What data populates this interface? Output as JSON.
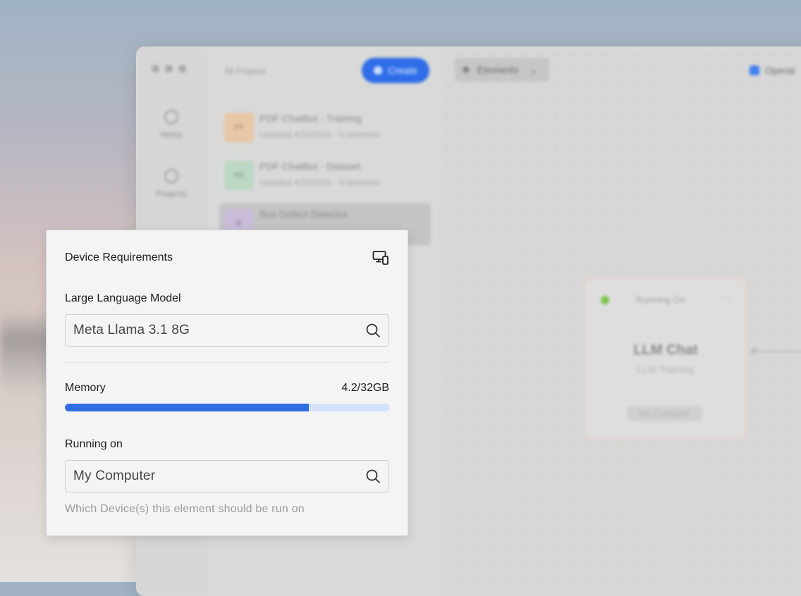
{
  "background_app": {
    "rail": [
      {
        "label": "Hosts"
      },
      {
        "label": "Projects"
      }
    ],
    "list_title": "All Projects",
    "create_label": "Create",
    "projects": [
      {
        "thumb": "PT",
        "title": "PDF ChatBot - Training",
        "meta": "Updated 4/22/2024 · 5 elements",
        "color": "#e7c7a6"
      },
      {
        "thumb": "PD",
        "title": "PDF ChatBot - Dataset",
        "meta": "Updated 4/22/2024 · 3 elements",
        "color": "#bcd8c5"
      },
      {
        "thumb": "B",
        "title": "Bus Defect Detector",
        "meta": "",
        "color": "#c9bcd8"
      }
    ],
    "elements_label": "Elements",
    "operations_label": "Operat",
    "node": {
      "status": "Running On",
      "more": "···",
      "title": "LLM Chat",
      "subtitle": "LLM Training",
      "chip": "My Computer"
    }
  },
  "panel": {
    "title": "Device Requirements",
    "header_icon": "device-settings-icon",
    "llm": {
      "label": "Large Language Model",
      "value": "Meta Llama 3.1 8G",
      "icon": "search-icon"
    },
    "memory": {
      "label": "Memory",
      "value_text": "4.2/32GB",
      "fill_fraction": 0.75
    },
    "running_on": {
      "label": "Running on",
      "value": "My Computer",
      "icon": "search-icon",
      "helper": "Which Device(s) this element should be run on"
    }
  },
  "colors": {
    "accent": "#2f6de3",
    "progress_track": "#d4e2fb",
    "panel_bg": "#f4f4f4"
  }
}
